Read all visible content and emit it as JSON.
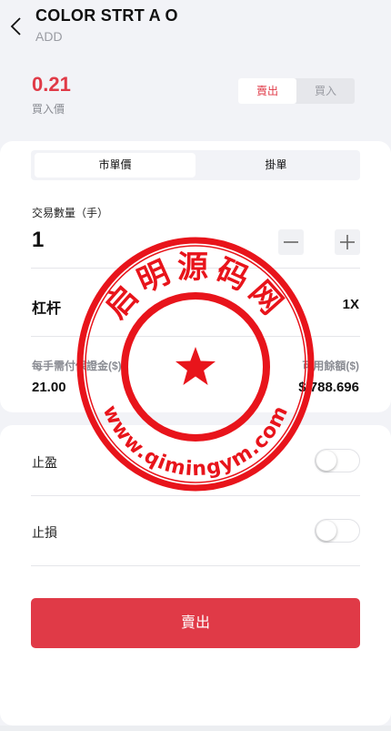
{
  "header": {
    "title": "COLOR STRT A O",
    "subtitle": "ADD",
    "back_icon": "chevron-left-icon"
  },
  "price": {
    "value": "0.21",
    "label": "買入價"
  },
  "side_switch": {
    "sell_label": "賣出",
    "buy_label": "買入",
    "active": "sell"
  },
  "order_type_tabs": [
    {
      "label": "市單價",
      "active": true
    },
    {
      "label": "掛單",
      "active": false
    }
  ],
  "quantity": {
    "label": "交易數量（手）",
    "value": "1",
    "minus_icon": "minus-icon",
    "plus_icon": "plus-icon"
  },
  "leverage": {
    "label": "杠杆",
    "value": "1X"
  },
  "margin_per_lot": {
    "label": "每手需付保證金($)",
    "value": "21.00"
  },
  "available_balance": {
    "label": "可用餘額($)",
    "value": "$ 788.696"
  },
  "take_profit": {
    "label": "止盈",
    "enabled": false
  },
  "stop_loss": {
    "label": "止損",
    "enabled": false
  },
  "submit": {
    "label": "賣出"
  },
  "watermark": {
    "top_text": "启明源码网",
    "bottom_text": "www.qimingym.com"
  },
  "colors": {
    "accent": "#e03a47",
    "background": "#f2f3f7",
    "card": "#ffffff",
    "muted_text": "#8a8c93",
    "seal_red": "#e8141b"
  }
}
